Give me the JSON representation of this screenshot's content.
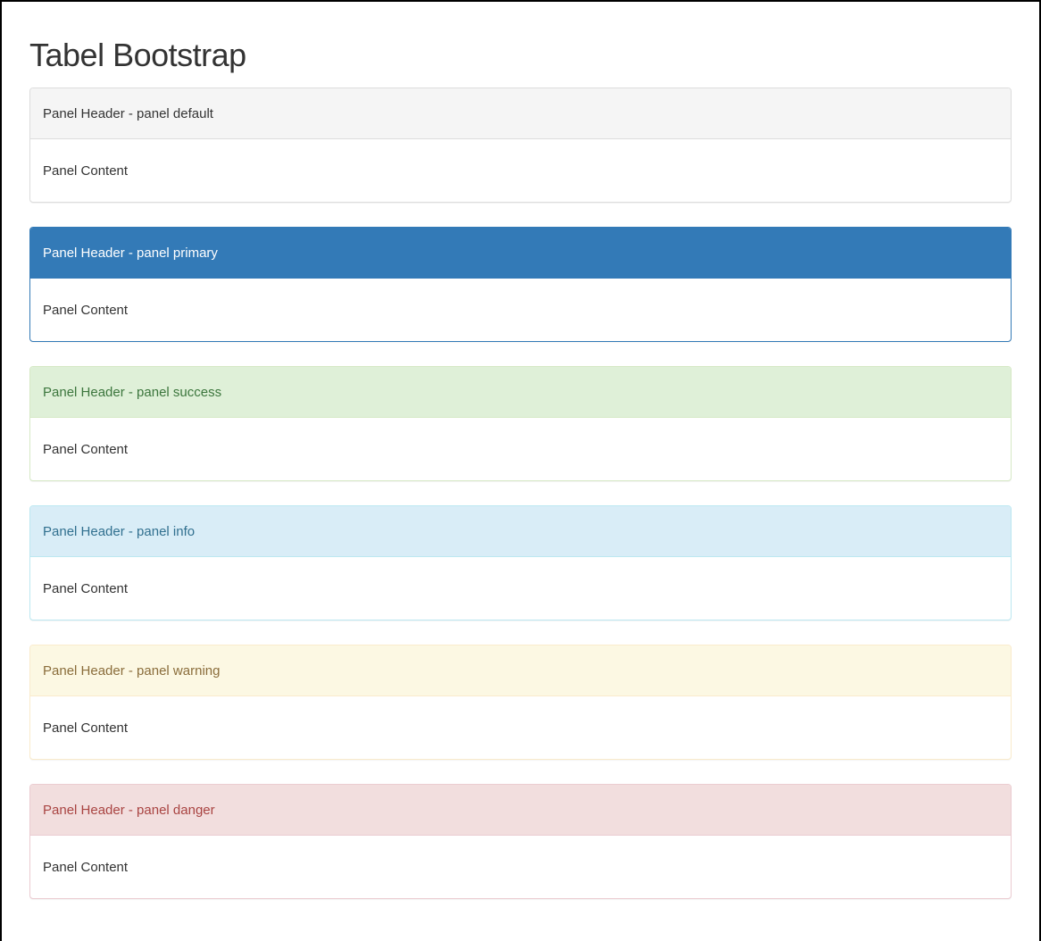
{
  "page": {
    "title": "Tabel Bootstrap"
  },
  "panels": [
    {
      "variant": "default",
      "header": "Panel Header - panel default",
      "content": "Panel Content",
      "header_bg": "#f5f5f5",
      "header_color": "#333333",
      "border_color": "#dddddd"
    },
    {
      "variant": "primary",
      "header": "Panel Header - panel primary",
      "content": "Panel Content",
      "header_bg": "#337ab7",
      "header_color": "#ffffff",
      "border_color": "#337ab7"
    },
    {
      "variant": "success",
      "header": "Panel Header - panel success",
      "content": "Panel Content",
      "header_bg": "#dff0d8",
      "header_color": "#3c763d",
      "border_color": "#d6e9c6"
    },
    {
      "variant": "info",
      "header": "Panel Header - panel info",
      "content": "Panel Content",
      "header_bg": "#d9edf7",
      "header_color": "#31708f",
      "border_color": "#bce8f1"
    },
    {
      "variant": "warning",
      "header": "Panel Header - panel warning",
      "content": "Panel Content",
      "header_bg": "#fcf8e3",
      "header_color": "#8a6d3b",
      "border_color": "#faebcc"
    },
    {
      "variant": "danger",
      "header": "Panel Header - panel danger",
      "content": "Panel Content",
      "header_bg": "#f2dede",
      "header_color": "#a94442",
      "border_color": "#ebccd1"
    }
  ]
}
